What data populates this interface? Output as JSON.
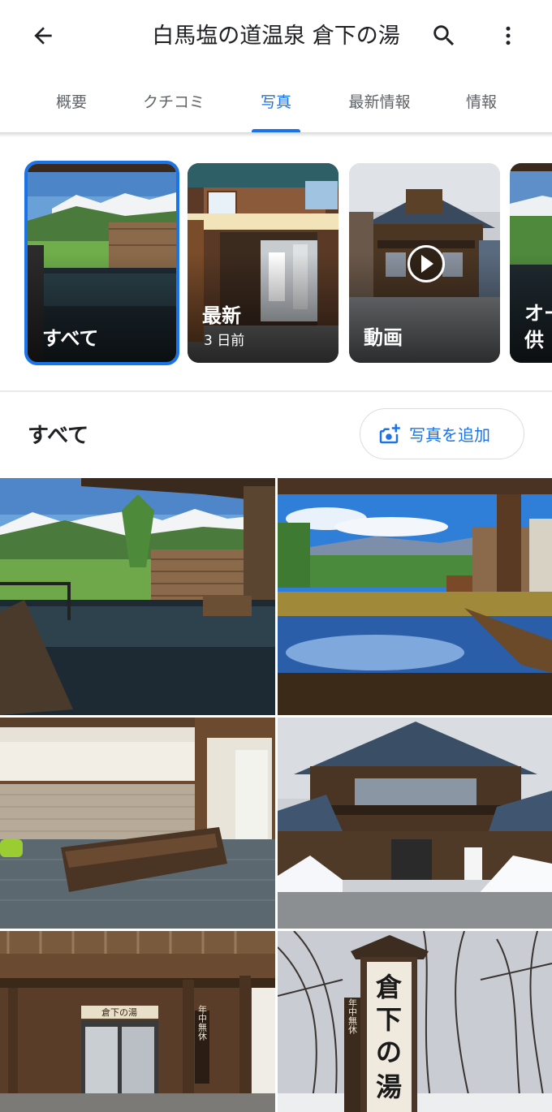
{
  "header": {
    "title": "白馬塩の道温泉 倉下の湯",
    "back_icon": "arrow-back-icon",
    "search_icon": "search-icon",
    "more_icon": "more-vert-icon"
  },
  "tabs": [
    {
      "label": "概要"
    },
    {
      "label": "クチコミ"
    },
    {
      "label": "写真",
      "active": true
    },
    {
      "label": "最新情報"
    },
    {
      "label": "情報"
    }
  ],
  "categories": [
    {
      "label": "すべて",
      "selected": true
    },
    {
      "label": "最新",
      "sub": "3 日前"
    },
    {
      "label": "動画"
    },
    {
      "label": "オー",
      "label2": "供"
    }
  ],
  "section": {
    "title": "すべて",
    "add_photo_label": "写真を追加"
  },
  "grid_signs": {
    "sign_kurashita": "倉下の湯",
    "sign_nenju": "年中無休",
    "pillar_kura": "倉",
    "pillar_shita": "下",
    "pillar_no": "の",
    "pillar_yu": "湯",
    "pillar_small": "年中無休"
  },
  "colors": {
    "accent": "#1a73e8",
    "text_primary": "#202124",
    "text_secondary": "#5f6368",
    "divider": "#e8eaed"
  }
}
